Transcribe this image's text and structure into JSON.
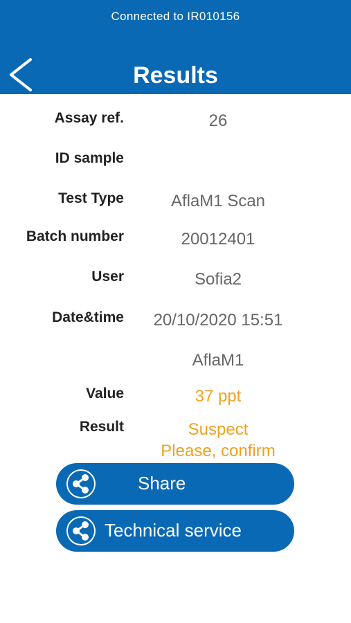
{
  "header": {
    "connection_status": "Connected to IR010156",
    "title": "Results"
  },
  "rows": [
    {
      "label": "Assay ref.",
      "value": "26"
    },
    {
      "label": "ID sample",
      "value": ""
    },
    {
      "label": "Test Type",
      "value": "AflaM1 Scan"
    },
    {
      "label": "Batch number",
      "value": "20012401"
    },
    {
      "label": "User",
      "value": "Sofia2"
    },
    {
      "label": "Date&time",
      "value": "20/10/2020 15:51"
    },
    {
      "label": "",
      "value": "AflaM1"
    },
    {
      "label": "Value",
      "value": "37 ppt"
    }
  ],
  "result": {
    "label": "Result",
    "line1": "Suspect",
    "line2": "Please, confirm"
  },
  "buttons": {
    "share_label": "Share",
    "technical_label": "Technical service"
  },
  "colors": {
    "brand_blue": "#0a69b4",
    "warning_orange": "#f0a21d"
  }
}
